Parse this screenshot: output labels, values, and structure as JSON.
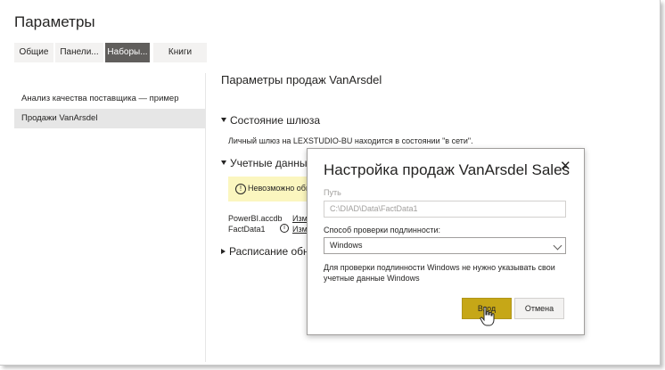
{
  "page": {
    "title": "Параметры"
  },
  "tabs": [
    {
      "label": "Общие"
    },
    {
      "label": "Панели..."
    },
    {
      "label": "Наборы..."
    },
    {
      "label": "Книги"
    }
  ],
  "sidebar": {
    "items": [
      {
        "label": "Анализ качества поставщика — пример"
      },
      {
        "label": "Продажи VanArsdel"
      }
    ]
  },
  "main": {
    "title": "Параметры продаж VanArsdel",
    "gateway": {
      "header": "Состояние шлюза",
      "text": "Личный шлюз на LEXSTUDIO-BU находится в состоянии \"в сети\"."
    },
    "credentials": {
      "header": "Учетные данные",
      "warning": "Невозможно обновить",
      "rows": [
        {
          "name": "PowerBI.accdb",
          "link": "Изменить"
        },
        {
          "name": "FactData1",
          "link": "Изменить"
        }
      ]
    },
    "schedule": {
      "header": "Расписание обн"
    }
  },
  "modal": {
    "title": "Настройка продаж VanArsdel Sales",
    "close": "✕",
    "path_label": "Путь",
    "path_value": "C:\\DIAD\\Data\\FactData1",
    "auth_label": "Способ проверки подлинности:",
    "auth_value": "Windows",
    "hint": "Для проверки подлинности Windows не нужно указывать свои учетные данные Windows",
    "signin": "Вход",
    "cancel": "Отмена"
  },
  "colors": {
    "active_tab": "#605e5c",
    "warning_bg": "#fbf6bf",
    "primary_button": "#c6a717"
  }
}
